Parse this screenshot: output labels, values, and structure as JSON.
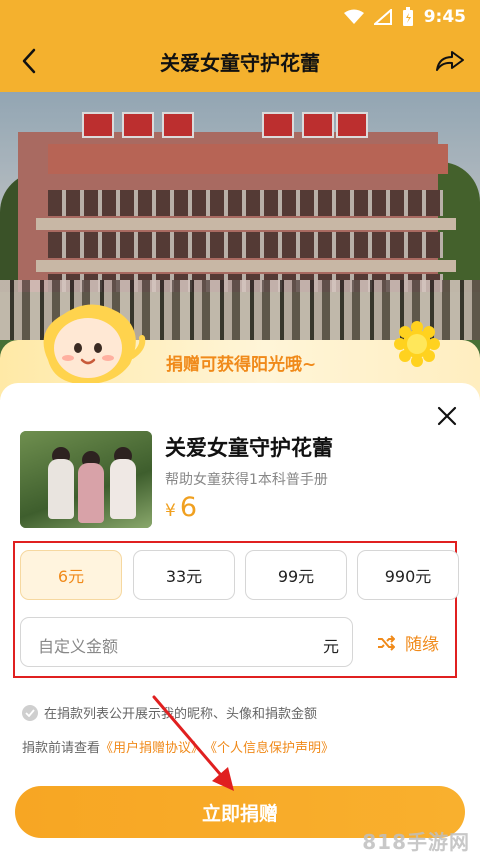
{
  "status_bar": {
    "time": "9:45"
  },
  "header": {
    "title": "关爱女童守护花蕾"
  },
  "banner": {
    "sun_text": "捐赠可获得阳光哦~"
  },
  "product": {
    "title": "关爱女童守护花蕾",
    "subtitle": "帮助女童获得1本科普手册",
    "price_symbol": "¥",
    "price_value": "6"
  },
  "amount_options": [
    "6元",
    "33元",
    "99元",
    "990元"
  ],
  "selected_amount_index": 0,
  "custom_amount": {
    "placeholder": "自定义金额",
    "unit": "元"
  },
  "random_button": {
    "label": "随缘"
  },
  "consent": {
    "text": "在捐款列表公开展示我的昵称、头像和捐款金额",
    "checked": true
  },
  "agreement": {
    "prefix": "捐款前请查看",
    "user_agreement": "《用户捐赠协议》",
    "privacy_statement": "《个人信息保护声明》"
  },
  "donate_button": {
    "label": "立即捐赠"
  },
  "watermark": {
    "text": "818手游网"
  },
  "colors": {
    "accent": "#f7a623",
    "highlight_red": "#e02020",
    "orange_text": "#f08a1a"
  }
}
